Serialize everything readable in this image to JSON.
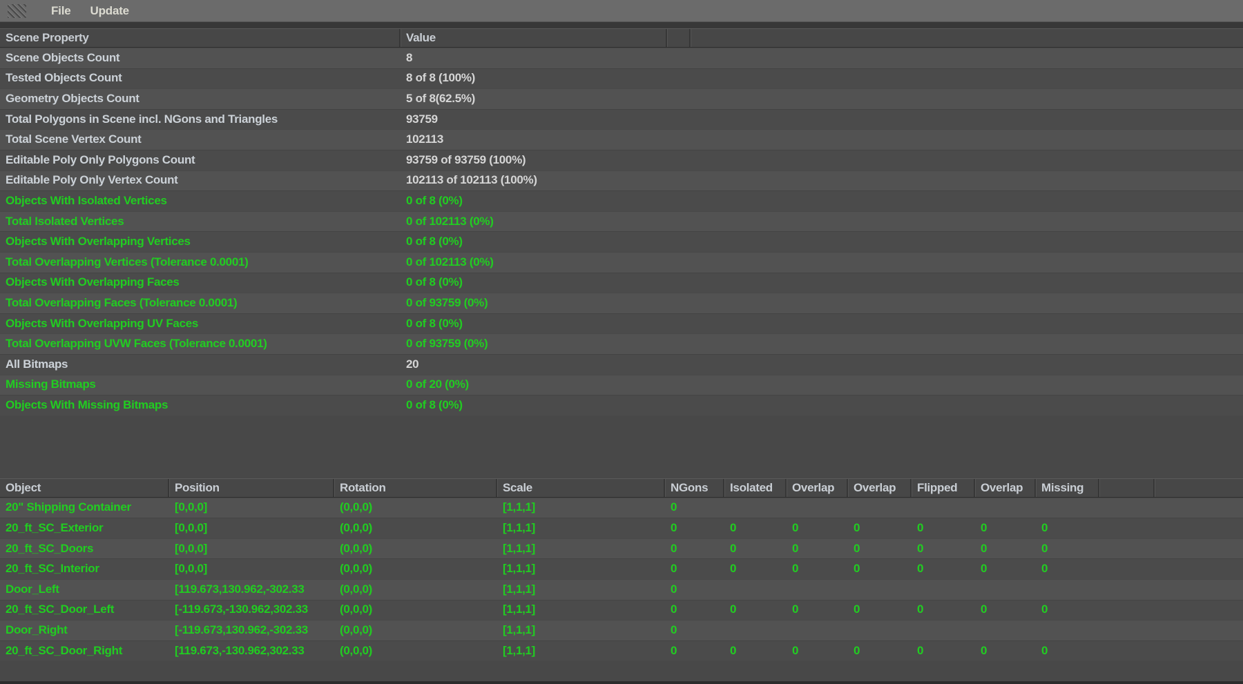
{
  "menu": {
    "items": [
      {
        "label": "File"
      },
      {
        "label": "Update"
      }
    ]
  },
  "icons": {
    "grip": "grip-dots-icon"
  },
  "scene_table": {
    "columns": {
      "property": "Scene Property",
      "value": "Value"
    },
    "rows": [
      {
        "property": "Scene Objects Count",
        "value": "8",
        "status": "normal"
      },
      {
        "property": "Tested Objects Count",
        "value": "8 of 8 (100%)",
        "status": "normal"
      },
      {
        "property": "Geometry Objects Count",
        "value": "5 of 8(62.5%)",
        "status": "normal"
      },
      {
        "property": "Total Polygons in Scene incl. NGons and Triangles",
        "value": "93759",
        "status": "normal"
      },
      {
        "property": "Total Scene Vertex Count",
        "value": "102113",
        "status": "normal"
      },
      {
        "property": "Editable Poly Only Polygons Count",
        "value": "93759 of 93759 (100%)",
        "status": "normal"
      },
      {
        "property": "Editable Poly Only Vertex Count",
        "value": "102113 of 102113 (100%)",
        "status": "normal"
      },
      {
        "property": "Objects With Isolated Vertices",
        "value": "0 of 8 (0%)",
        "status": "ok"
      },
      {
        "property": "Total Isolated Vertices",
        "value": "0 of 102113 (0%)",
        "status": "ok"
      },
      {
        "property": "Objects With Overlapping Vertices",
        "value": "0 of 8 (0%)",
        "status": "ok"
      },
      {
        "property": "Total Overlapping Vertices (Tolerance 0.0001)",
        "value": "0 of 102113 (0%)",
        "status": "ok"
      },
      {
        "property": "Objects With Overlapping Faces",
        "value": "0 of 8 (0%)",
        "status": "ok"
      },
      {
        "property": "Total Overlapping Faces (Tolerance 0.0001)",
        "value": "0 of 93759 (0%)",
        "status": "ok"
      },
      {
        "property": "Objects With Overlapping UV Faces",
        "value": "0 of 8 (0%)",
        "status": "ok"
      },
      {
        "property": "Total Overlapping UVW Faces (Tolerance 0.0001)",
        "value": "0 of 93759 (0%)",
        "status": "ok"
      },
      {
        "property": "All Bitmaps",
        "value": "20",
        "status": "normal"
      },
      {
        "property": "Missing Bitmaps",
        "value": "0 of 20 (0%)",
        "status": "ok"
      },
      {
        "property": "Objects With Missing Bitmaps",
        "value": "0 of 8 (0%)",
        "status": "ok"
      }
    ]
  },
  "object_table": {
    "headers": [
      "Object",
      "Position",
      "Rotation",
      "Scale",
      "NGons",
      "Isolated",
      "Overlap",
      "Overlap",
      "Flipped",
      "Overlap",
      "Missing"
    ],
    "rows": [
      {
        "object": "20\" Shipping Container",
        "position": "[0,0,0]",
        "rotation": "(0,0,0)",
        "scale": "[1,1,1]",
        "flags": [
          "0",
          "",
          "",
          "",
          "",
          "",
          ""
        ]
      },
      {
        "object": "20_ft_SC_Exterior",
        "position": "[0,0,0]",
        "rotation": "(0,0,0)",
        "scale": "[1,1,1]",
        "flags": [
          "0",
          "0",
          "0",
          "0",
          "0",
          "0",
          "0"
        ]
      },
      {
        "object": "20_ft_SC_Doors",
        "position": "[0,0,0]",
        "rotation": "(0,0,0)",
        "scale": "[1,1,1]",
        "flags": [
          "0",
          "0",
          "0",
          "0",
          "0",
          "0",
          "0"
        ]
      },
      {
        "object": "20_ft_SC_Interior",
        "position": "[0,0,0]",
        "rotation": "(0,0,0)",
        "scale": "[1,1,1]",
        "flags": [
          "0",
          "0",
          "0",
          "0",
          "0",
          "0",
          "0"
        ]
      },
      {
        "object": "Door_Left",
        "position": "[119.673,130.962,-302.33",
        "rotation": "(0,0,0)",
        "scale": "[1,1,1]",
        "flags": [
          "0",
          "",
          "",
          "",
          "",
          "",
          ""
        ]
      },
      {
        "object": "20_ft_SC_Door_Left",
        "position": "[-119.673,-130.962,302.33",
        "rotation": "(0,0,0)",
        "scale": "[1,1,1]",
        "flags": [
          "0",
          "0",
          "0",
          "0",
          "0",
          "0",
          "0"
        ]
      },
      {
        "object": "Door_Right",
        "position": "[-119.673,130.962,-302.33",
        "rotation": "(0,0,0)",
        "scale": "[1,1,1]",
        "flags": [
          "0",
          "",
          "",
          "",
          "",
          "",
          ""
        ]
      },
      {
        "object": "20_ft_SC_Door_Right",
        "position": "[119.673,-130.962,302.33",
        "rotation": "(0,0,0)",
        "scale": "[1,1,1]",
        "flags": [
          "0",
          "0",
          "0",
          "0",
          "0",
          "0",
          "0"
        ]
      }
    ]
  },
  "colors": {
    "ok_green": "#21cd21",
    "light_text": "#d6d6d6",
    "header_text": "#c9ced4",
    "menubar_bg": "#6b6b6b",
    "header_bg": "#474747",
    "row_light": "#525252",
    "row_dark": "#4b4b4b",
    "background": "#484848"
  }
}
